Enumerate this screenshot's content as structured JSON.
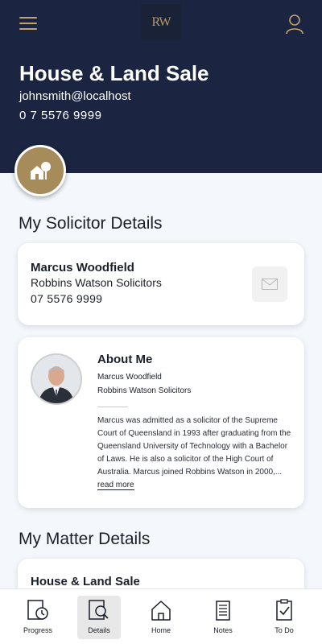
{
  "header": {
    "logo_text": "RW",
    "title": "House & Land Sale",
    "email": "johnsmith@localhost",
    "phone": "0 7 5576 9999"
  },
  "solicitor_section": {
    "heading": "My Solicitor Details",
    "name": "Marcus Woodfield",
    "firm": "Robbins Watson Solicitors",
    "phone": "07 5576 9999"
  },
  "about": {
    "heading": "About Me",
    "name": "Marcus Woodfield",
    "firm": "Robbins Watson Solicitors",
    "bio": "Marcus was admitted as a solicitor of the Supreme Court of Queensland in 1993 after graduating from the Queensland University of Technology with a Bachelor of Laws. He is also a solicitor of the High Court of Australia. Marcus joined Robbins Watson in 2000,...",
    "read_more": "read more"
  },
  "matter_section": {
    "heading": "My Matter Details",
    "title": "House & Land Sale"
  },
  "nav": {
    "progress": "Progress",
    "details": "Details",
    "home": "Home",
    "notes": "Notes",
    "todo": "To Do",
    "active": "details"
  },
  "colors": {
    "header_bg": "#1b2440",
    "accent_gold": "#c2a46a",
    "badge_gold": "#a68c5b",
    "page_bg": "#f4f8fc"
  }
}
